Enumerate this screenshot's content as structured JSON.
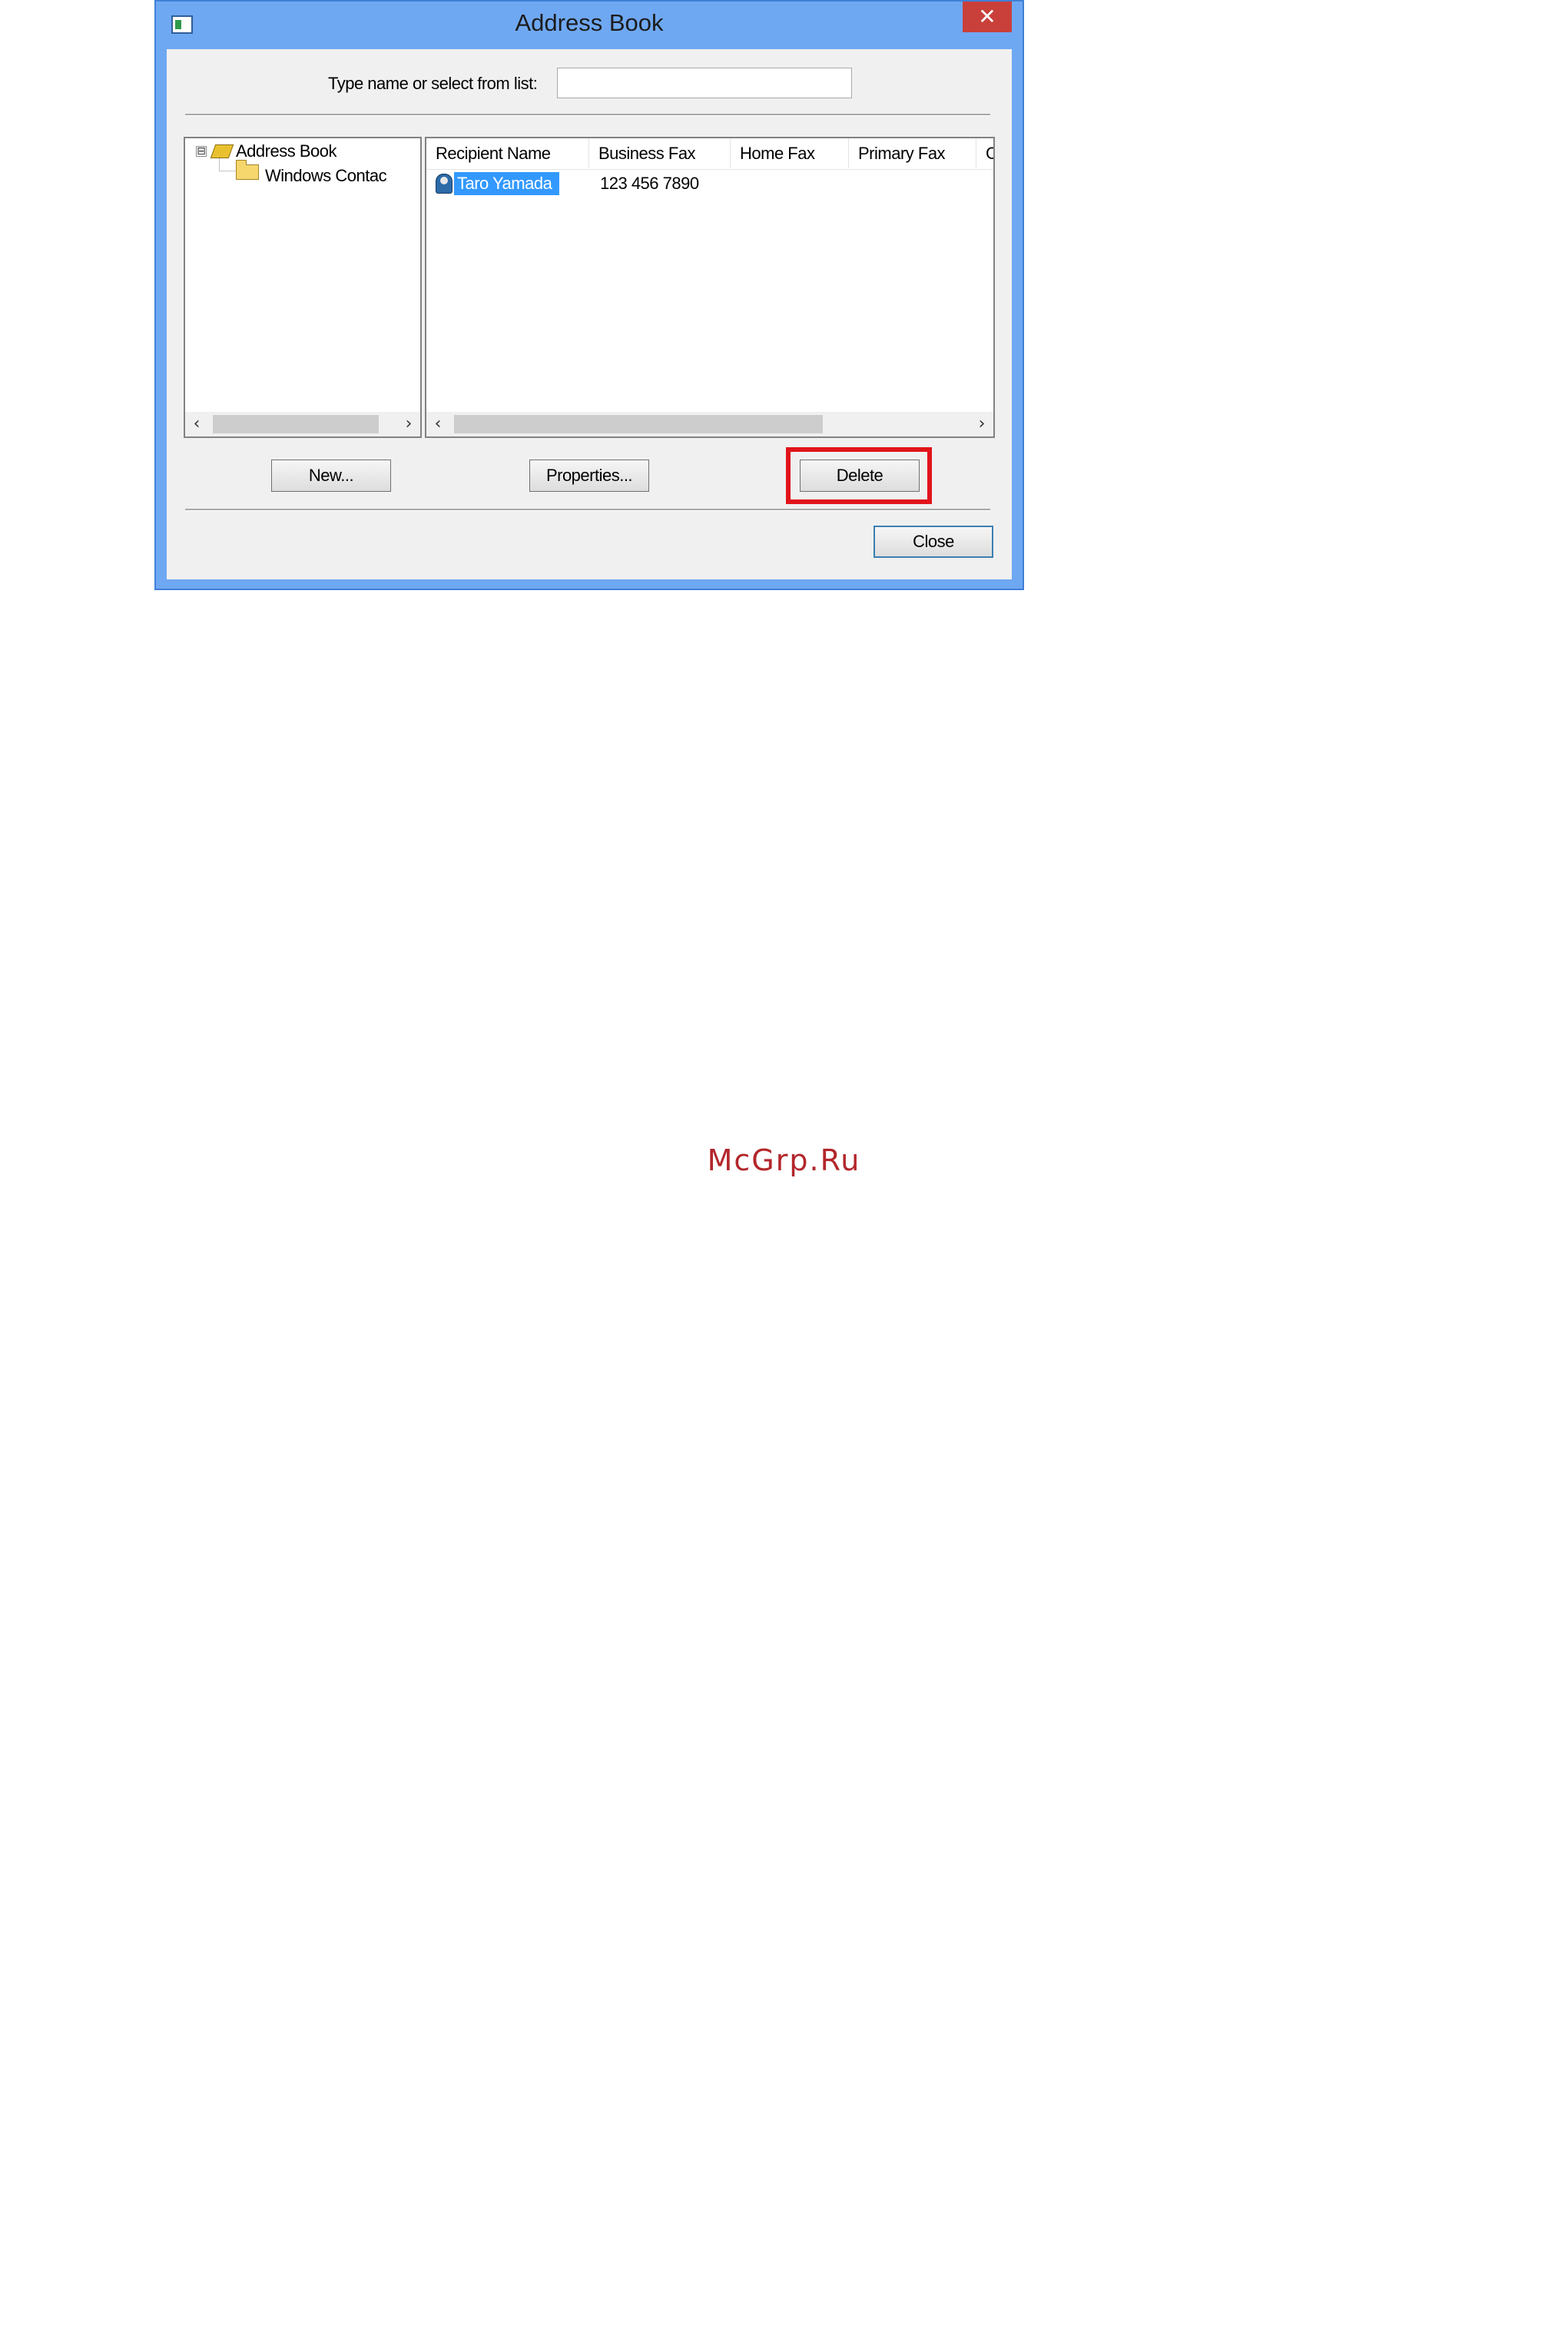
{
  "window": {
    "title": "Address Book",
    "close_glyph": "✕"
  },
  "search": {
    "label": "Type name or select from list:",
    "value": "",
    "placeholder": ""
  },
  "tree": {
    "items": [
      {
        "label": "Address Book",
        "icon": "address-book-icon",
        "expander": "⊟"
      },
      {
        "label": "Windows Contac",
        "icon": "folder-icon"
      }
    ]
  },
  "list": {
    "columns": [
      "Recipient Name",
      "Business Fax",
      "Home Fax",
      "Primary Fax",
      "C"
    ],
    "rows": [
      {
        "recipient_name": "Taro Yamada",
        "business_fax": "123 456 7890",
        "home_fax": "",
        "primary_fax": "",
        "selected": true,
        "icon": "contact-icon"
      }
    ]
  },
  "scroll": {
    "left_arrow": "‹",
    "right_arrow": "›"
  },
  "buttons": {
    "new_label": "New...",
    "properties_label": "Properties...",
    "delete_label": "Delete",
    "close_label": "Close"
  },
  "annotation": {
    "highlight_color": "#e1141a",
    "highlight_target": "Delete"
  },
  "watermark": {
    "text": "McGrp.Ru"
  },
  "colors": {
    "title_bar": "#6fa8f2",
    "close_button": "#c9403a",
    "selection": "#3399ff"
  }
}
